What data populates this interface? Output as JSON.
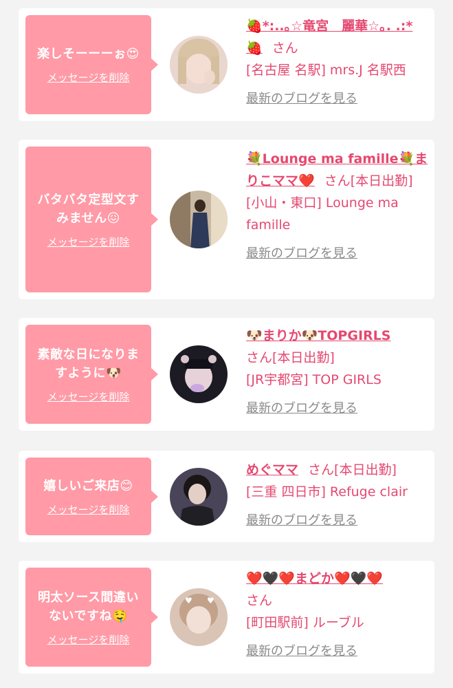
{
  "messages": [
    {
      "bubble_text": "楽しそーーーぉ😍",
      "delete_label": "メッセージを削除",
      "name": "🍓*:..｡☆竜宮　麗華☆｡. .:*🍓",
      "san": "さん",
      "status": "",
      "shop": "[名古屋 名駅] mrs.J 名駅西",
      "blog_label": "最新のブログを見る"
    },
    {
      "bubble_text": "バタバタ定型文すみません😖",
      "delete_label": "メッセージを削除",
      "name": "💐Lounge ma famille💐まりこママ❤️",
      "san": "さん",
      "status": "[本日出勤]",
      "shop": "[小山・東口] Lounge ma famille",
      "blog_label": "最新のブログを見る"
    },
    {
      "bubble_text": "素敵な日になりますように🐶",
      "delete_label": "メッセージを削除",
      "name": "🐶まりか🐶TOPGIRLS",
      "san": "さん",
      "status": "[本日出勤]",
      "shop": "[JR宇都宮] TOP GIRLS",
      "blog_label": "最新のブログを見る"
    },
    {
      "bubble_text": "嬉しいご来店😊",
      "delete_label": "メッセージを削除",
      "name": "めぐママ",
      "san": "さん",
      "status": "[本日出勤]",
      "shop": "[三重 四日市] Refuge clair",
      "blog_label": "最新のブログを見る"
    },
    {
      "bubble_text": "明太ソース間違いないですね🤤",
      "delete_label": "メッセージを削除",
      "name": "❤️🖤❤️まどか❤️🖤❤️",
      "san": "さん",
      "status": "",
      "shop": "[町田駅前] ルーブル",
      "blog_label": "最新のブログを見る"
    }
  ],
  "colors": {
    "bubble": "#ff9aa6",
    "accent": "#e54870",
    "link_gray": "#8a8a8a",
    "background": "#f3f3f3"
  },
  "icons": [
    "avatar-photo-1",
    "avatar-photo-2",
    "avatar-photo-3",
    "avatar-photo-4",
    "avatar-photo-5"
  ]
}
